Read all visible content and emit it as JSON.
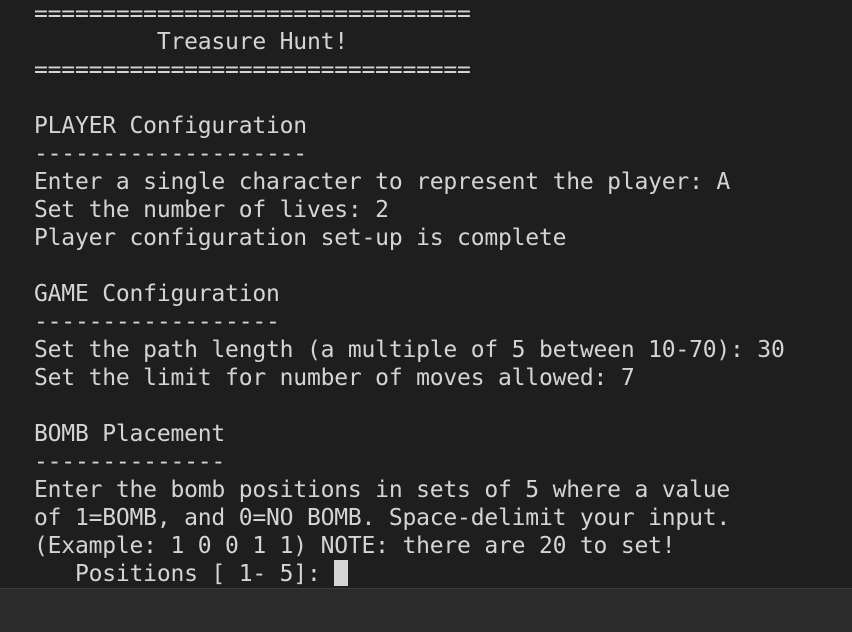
{
  "terminal": {
    "lines": [
      "================================",
      "         Treasure Hunt!",
      "================================",
      "",
      "PLAYER Configuration",
      "--------------------",
      "Enter a single character to represent the player: A",
      "Set the number of lives: 2",
      "Player configuration set-up is complete",
      "",
      "GAME Configuration",
      "------------------",
      "Set the path length (a multiple of 5 between 10-70): 30",
      "Set the limit for number of moves allowed: 7",
      "",
      "BOMB Placement",
      "--------------",
      "Enter the bomb positions in sets of 5 where a value",
      "of 1=BOMB, and 0=NO BOMB. Space-delimit your input.",
      "(Example: 1 0 0 1 1) NOTE: there are 20 to set!"
    ],
    "prompt": "   Positions [ 1- 5]: "
  }
}
